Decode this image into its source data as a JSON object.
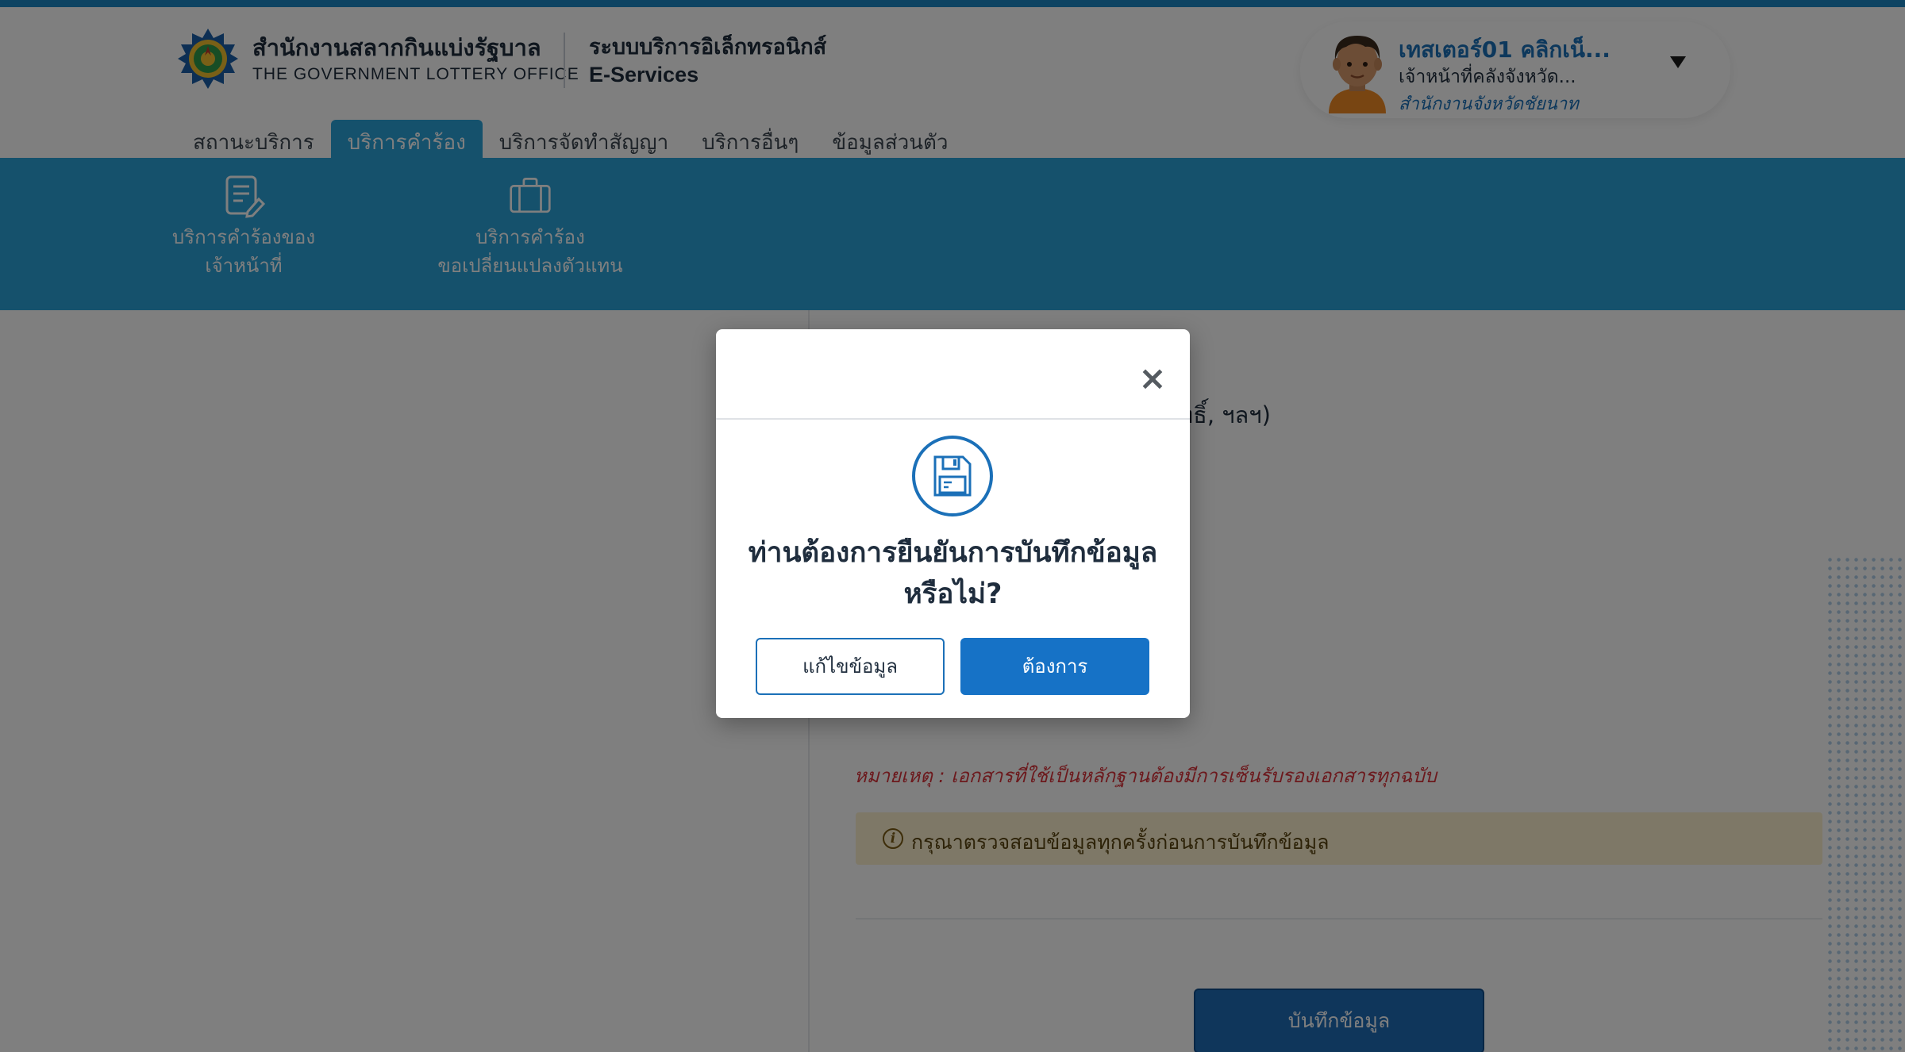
{
  "colors": {
    "brand_blue": "#1b70b8",
    "submenu_cyan": "#2aa2d8",
    "top_stripe": "#1a86c4",
    "remark_red": "#d8333a",
    "alert_bg": "#fdf1cf",
    "primary_button": "#1672c6"
  },
  "header": {
    "org_name_th": "สำนักงานสลากกินแบ่งรัฐบาล",
    "org_name_en": "THE GOVERNMENT LOTTERY OFFICE",
    "system_name_th": "ระบบบริการอิเล็กทรอนิกส์",
    "system_name_en": "E-Services",
    "logo_icon": "government-lottery-seal-icon"
  },
  "user": {
    "name": "เทสเตอร์01 คลิกเน็...",
    "role": "เจ้าหน้าที่คลังจังหวัด...",
    "office": "สำนักงานจังหวัดชัยนาท",
    "avatar_icon": "user-avatar-icon",
    "menu_icon": "caret-down-icon"
  },
  "nav": {
    "tabs": [
      {
        "label": "สถานะบริการ",
        "active": false
      },
      {
        "label": "บริการคำร้อง",
        "active": true
      },
      {
        "label": "บริการจัดทำสัญญา",
        "active": false
      },
      {
        "label": "บริการอื่นๆ",
        "active": false
      },
      {
        "label": "ข้อมูลส่วนตัว",
        "active": false
      }
    ]
  },
  "submenu": {
    "items": [
      {
        "icon": "document-edit-icon",
        "line1": "บริการคำร้องของ",
        "line2": "เจ้าหน้าที่"
      },
      {
        "icon": "briefcase-icon",
        "line1": "บริการคำร้อง",
        "line2": "ขอเปลี่ยนแปลงตัวแทน"
      }
    ]
  },
  "main": {
    "partial_text": "ทธิ์, ฯลฯ)",
    "remark": "หมายเหตุ : เอกสารที่ใช้เป็นหลักฐานต้องมีการเซ็นรับรองเอกสารทุกฉบับ",
    "alert": {
      "icon": "info-icon",
      "icon_glyph": "i",
      "text": "กรุณาตรวจสอบข้อมูลทุกครั้งก่อนการบันทึกข้อมูล"
    },
    "save_button": "บันทึกข้อมูล"
  },
  "modal": {
    "close_glyph": "×",
    "icon": "floppy-disk-icon",
    "title_line1": "ท่านต้องการยืนยันการบันทึกข้อมูล",
    "title_line2": "หรือไม่?",
    "edit_button": "แก้ไขข้อมูล",
    "confirm_button": "ต้องการ"
  }
}
